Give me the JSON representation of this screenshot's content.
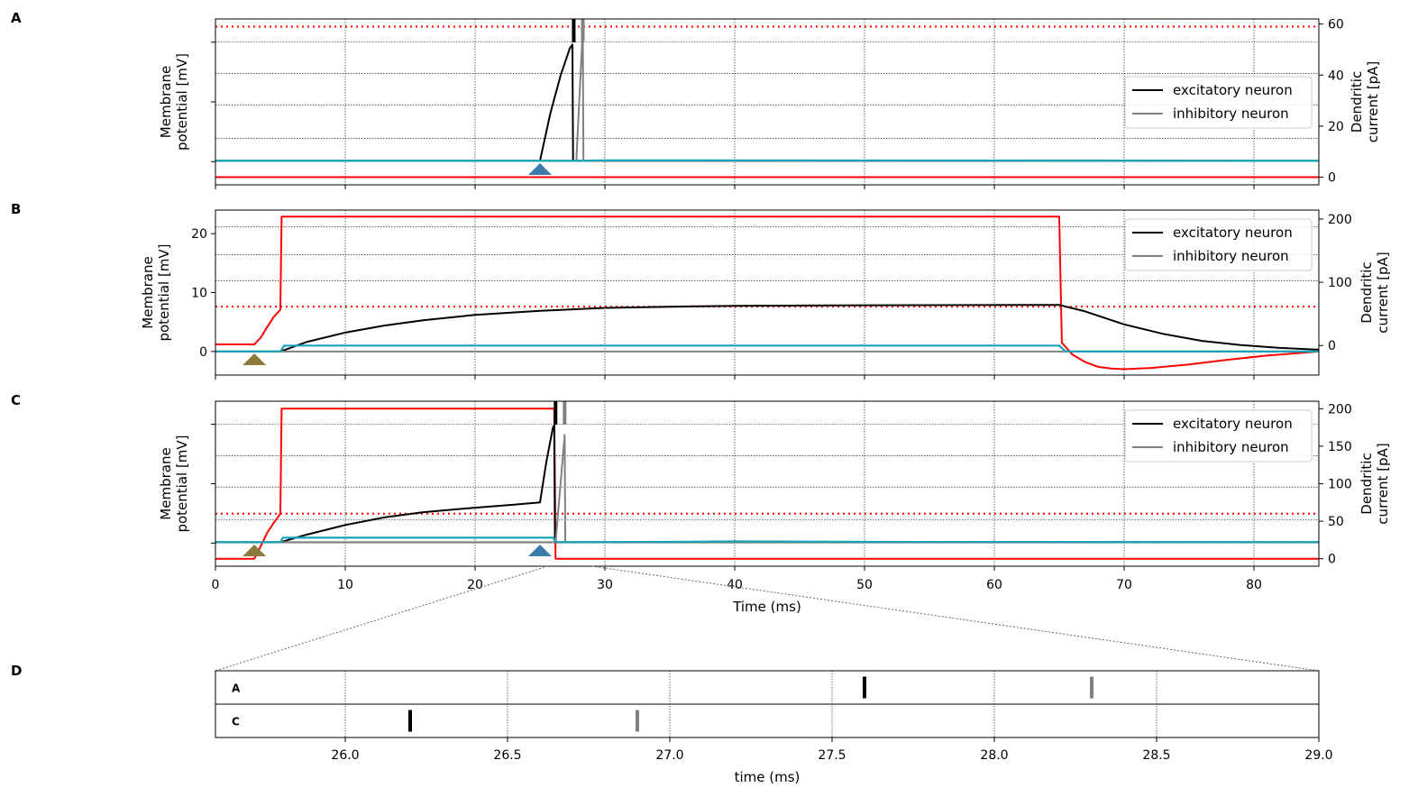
{
  "colors": {
    "excitatory": "#000000",
    "inhibitory": "#808080",
    "current": "#ff0000",
    "threshold_line": "#ff0000",
    "dendritic_trace": "#17a2b8",
    "marker_blue": "#3d7ba8",
    "marker_olive": "#8c7a3c"
  },
  "chart_data": [
    {
      "panel": "A",
      "type": "line",
      "ylabel": "Membrane potential [mV]",
      "ylabel_right": "Dendritic current [pA]",
      "right_ylim": [
        -3,
        62
      ],
      "right_ticks": [
        "0",
        "20",
        "40",
        "60"
      ],
      "right_tick_values": [
        0,
        20,
        40,
        60
      ],
      "xlim": [
        0,
        85
      ],
      "threshold_level_pA": 59,
      "legend": [
        "excitatory neuron",
        "inhibitory neuron"
      ],
      "legend_position": "right",
      "markers": [
        {
          "time_ms": 25,
          "color": "blue"
        }
      ],
      "spikes": [
        {
          "neuron": "excitatory",
          "time_ms": 27.6
        },
        {
          "neuron": "inhibitory",
          "time_ms": 28.3
        }
      ],
      "series": [
        {
          "name": "excitatory neuron",
          "role": "membrane",
          "points_ms_pA": [
            [
              0,
              6.4
            ],
            [
              25,
              6.4
            ],
            [
              25.8,
              25
            ],
            [
              26.6,
              40
            ],
            [
              27.3,
              50.5
            ],
            [
              27.5,
              52
            ],
            [
              27.55,
              6.4
            ],
            [
              27.6,
              6.4
            ],
            [
              85,
              6.4
            ]
          ]
        },
        {
          "name": "inhibitory neuron",
          "role": "membrane",
          "points_ms_pA": [
            [
              0,
              6.4
            ],
            [
              27.8,
              6.4
            ],
            [
              28.3,
              58
            ],
            [
              28.35,
              6.4
            ],
            [
              85,
              6.4
            ]
          ]
        },
        {
          "name": "dendritic",
          "role": "dendritic",
          "points_ms_pA": [
            [
              0,
              6.4
            ],
            [
              28.5,
              6.4
            ],
            [
              30,
              6.6
            ],
            [
              85,
              6.4
            ]
          ]
        },
        {
          "name": "current",
          "role": "current",
          "points_ms_pA": [
            [
              0,
              0
            ],
            [
              85,
              0
            ]
          ]
        }
      ]
    },
    {
      "panel": "B",
      "type": "line",
      "ylabel": "Membrane potential [mV]",
      "ylabel_right": "Dendritic current [pA]",
      "left_ylim": [
        -4,
        24
      ],
      "left_ticks": [
        "0",
        "10",
        "20"
      ],
      "left_tick_values": [
        0,
        10,
        20
      ],
      "right_ylim": [
        -46.7,
        214.2
      ],
      "right_ticks": [
        "0",
        "100",
        "200"
      ],
      "right_tick_values": [
        0,
        100,
        200
      ],
      "xlim": [
        0,
        85
      ],
      "threshold_level_mV": 7.6,
      "legend": [
        "excitatory neuron",
        "inhibitory neuron"
      ],
      "legend_position": "upper right",
      "markers": [
        {
          "time_ms": 3,
          "color": "olive"
        }
      ],
      "series": [
        {
          "name": "current",
          "role": "current",
          "points_ms_mV": [
            [
              0,
              1.2
            ],
            [
              3,
              1.2
            ],
            [
              3.5,
              2.4
            ],
            [
              4,
              4.2
            ],
            [
              4.5,
              5.9
            ],
            [
              5,
              7.1
            ],
            [
              5.1,
              22.9
            ],
            [
              65,
              22.9
            ],
            [
              65.2,
              1.5
            ],
            [
              66,
              -0.5
            ],
            [
              67,
              -1.8
            ],
            [
              68,
              -2.6
            ],
            [
              69,
              -2.9
            ],
            [
              70,
              -3.0
            ],
            [
              72,
              -2.8
            ],
            [
              75,
              -2.2
            ],
            [
              78,
              -1.4
            ],
            [
              81,
              -0.7
            ],
            [
              85,
              0
            ]
          ]
        },
        {
          "name": "excitatory neuron",
          "role": "membrane",
          "points_ms_mV": [
            [
              0,
              0
            ],
            [
              5,
              0
            ],
            [
              7,
              1.6
            ],
            [
              10,
              3.2
            ],
            [
              13,
              4.4
            ],
            [
              16,
              5.3
            ],
            [
              20,
              6.2
            ],
            [
              25,
              6.9
            ],
            [
              30,
              7.4
            ],
            [
              35,
              7.6
            ],
            [
              40,
              7.75
            ],
            [
              50,
              7.85
            ],
            [
              65,
              7.9
            ],
            [
              67,
              6.8
            ],
            [
              70,
              4.6
            ],
            [
              73,
              3.0
            ],
            [
              76,
              1.8
            ],
            [
              79,
              1.1
            ],
            [
              82,
              0.6
            ],
            [
              85,
              0.3
            ]
          ]
        },
        {
          "name": "inhibitory neuron",
          "role": "membrane",
          "points_ms_mV": [
            [
              0,
              0
            ],
            [
              85,
              0
            ]
          ]
        },
        {
          "name": "dendritic",
          "role": "dendritic",
          "points_ms_mV": [
            [
              0,
              0
            ],
            [
              5,
              0
            ],
            [
              5.3,
              1
            ],
            [
              65,
              1
            ],
            [
              65.5,
              0
            ],
            [
              85,
              0
            ]
          ]
        }
      ]
    },
    {
      "panel": "C",
      "type": "line",
      "ylabel": "Membrane potential [mV]",
      "ylabel_right": "Dendritic current [pA]",
      "right_ylim": [
        -10,
        210
      ],
      "right_ticks": [
        "0",
        "50",
        "100",
        "150",
        "200"
      ],
      "right_tick_values": [
        0,
        50,
        100,
        150,
        200
      ],
      "xlim": [
        0,
        85
      ],
      "xlabel": "Time (ms)",
      "xticks": [
        "0",
        "10",
        "20",
        "30",
        "40",
        "50",
        "60",
        "70",
        "80"
      ],
      "xtick_values": [
        0,
        10,
        20,
        30,
        40,
        50,
        60,
        70,
        80
      ],
      "threshold_level_pA": 60,
      "legend": [
        "excitatory neuron",
        "inhibitory neuron"
      ],
      "legend_position": "upper right",
      "markers": [
        {
          "time_ms": 3,
          "color": "olive"
        },
        {
          "time_ms": 25,
          "color": "blue"
        }
      ],
      "spikes": [
        {
          "neuron": "excitatory",
          "time_ms": 26.2
        },
        {
          "neuron": "inhibitory",
          "time_ms": 26.9
        }
      ],
      "series": [
        {
          "name": "current",
          "role": "current",
          "points_ms_pA": [
            [
              0,
              0
            ],
            [
              3,
              0
            ],
            [
              3.5,
              17
            ],
            [
              4,
              35
            ],
            [
              4.5,
              48
            ],
            [
              5,
              60
            ],
            [
              5.1,
              200
            ],
            [
              26.1,
              200
            ],
            [
              26.2,
              0
            ],
            [
              85,
              0
            ]
          ]
        },
        {
          "name": "excitatory neuron",
          "role": "membrane",
          "points_ms_pA": [
            [
              0,
              22
            ],
            [
              5,
              22
            ],
            [
              7,
              32
            ],
            [
              10,
              45
            ],
            [
              13,
              55
            ],
            [
              16,
              62
            ],
            [
              20,
              68
            ],
            [
              23,
              72
            ],
            [
              25,
              75
            ],
            [
              25.5,
              130
            ],
            [
              26,
              175
            ],
            [
              26.1,
              178
            ],
            [
              26.15,
              22
            ],
            [
              85,
              22
            ]
          ]
        },
        {
          "name": "inhibitory neuron",
          "role": "membrane",
          "points_ms_pA": [
            [
              0,
              22
            ],
            [
              26.2,
              22
            ],
            [
              26.9,
              165
            ],
            [
              26.95,
              22
            ],
            [
              85,
              22
            ]
          ]
        },
        {
          "name": "dendritic",
          "role": "dendritic",
          "points_ms_pA": [
            [
              0,
              22
            ],
            [
              5,
              22
            ],
            [
              5.2,
              28
            ],
            [
              26,
              28
            ],
            [
              26.3,
              22
            ],
            [
              35,
              22.5
            ],
            [
              40,
              23
            ],
            [
              50,
              22.5
            ],
            [
              85,
              22
            ]
          ]
        }
      ]
    },
    {
      "panel": "D",
      "type": "scatter",
      "xlabel": "time (ms)",
      "xlim": [
        25.6,
        29.0
      ],
      "xticks": [
        "26.0",
        "26.5",
        "27.0",
        "27.5",
        "28.0",
        "28.5",
        "29.0"
      ],
      "xtick_values": [
        26.0,
        26.5,
        27.0,
        27.5,
        28.0,
        28.5,
        29.0
      ],
      "rows": [
        {
          "label": "A",
          "spikes": [
            {
              "neuron": "excitatory",
              "time_ms": 27.6
            },
            {
              "neuron": "inhibitory",
              "time_ms": 28.3
            }
          ]
        },
        {
          "label": "C",
          "spikes": [
            {
              "neuron": "excitatory",
              "time_ms": 26.2
            },
            {
              "neuron": "inhibitory",
              "time_ms": 26.9
            }
          ]
        }
      ]
    }
  ]
}
